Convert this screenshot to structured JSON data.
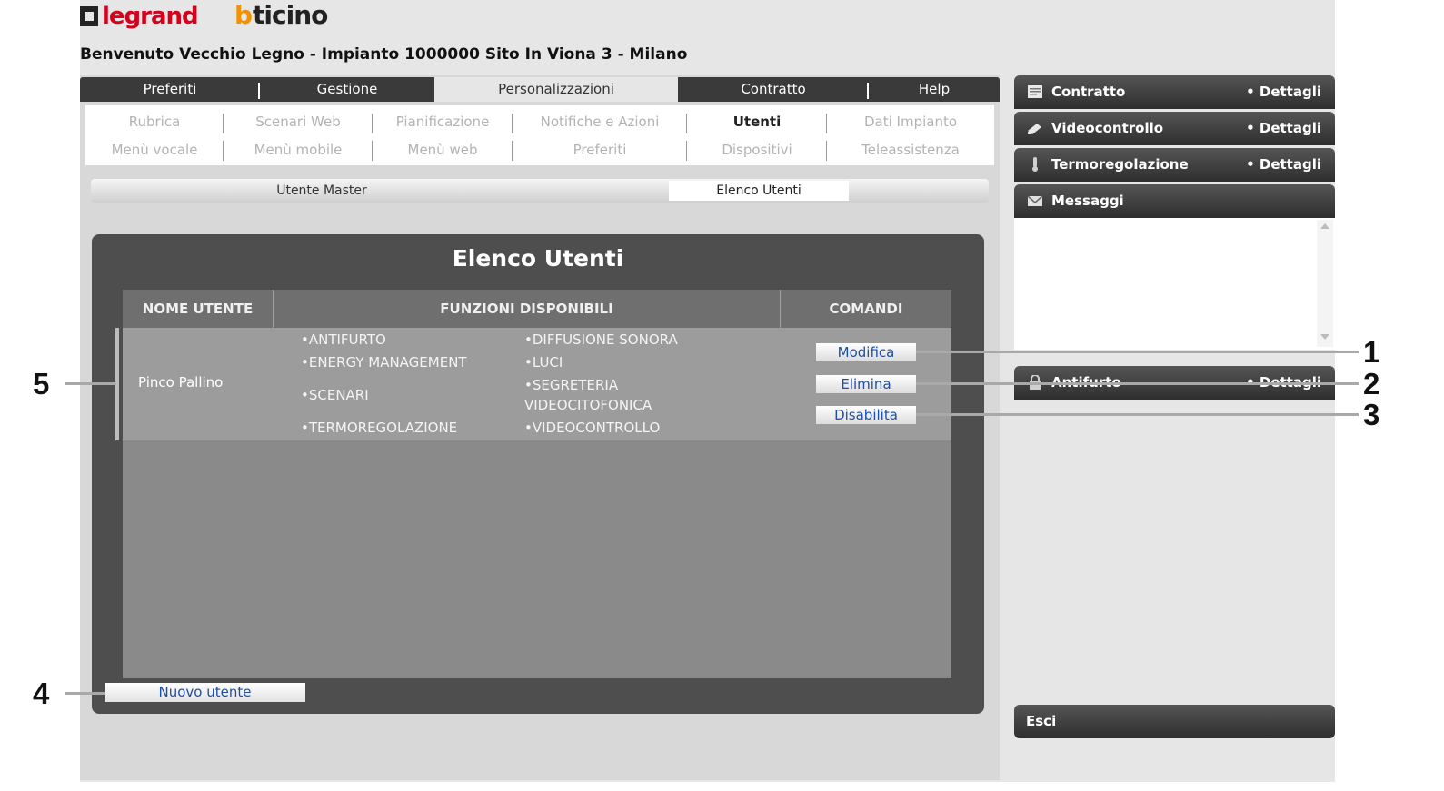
{
  "brand": {
    "legrand": "legrand",
    "bticino_b": "b",
    "bticino_rest": "ticino"
  },
  "welcome": "Benvenuto Vecchio Legno - Impianto 1000000 Sito In Viona 3 - Milano",
  "tabs": [
    {
      "label": "Preferiti"
    },
    {
      "label": "Gestione"
    },
    {
      "label": "Personalizzazioni",
      "active": true
    },
    {
      "label": "Contratto"
    },
    {
      "label": "Help"
    }
  ],
  "submenu": {
    "row1": [
      "Rubrica",
      "Scenari Web",
      "Pianificazione",
      "Notifiche e Azioni",
      "Utenti",
      "Dati Impianto"
    ],
    "row2": [
      "Menù vocale",
      "Menù mobile",
      "Menù web",
      "Preferiti",
      "Dispositivi",
      "Teleassistenza"
    ],
    "active": "Utenti"
  },
  "subtabs": {
    "master": "Utente Master",
    "elenco": "Elenco Utenti"
  },
  "panel": {
    "title": "Elenco Utenti",
    "headers": {
      "name": "NOME UTENTE",
      "functions": "FUNZIONI DISPONIBILI",
      "commands": "COMANDI"
    },
    "user": {
      "name": "Pinco Pallino",
      "functions_col1": [
        "•ANTIFURTO",
        "•ENERGY MANAGEMENT",
        "•SCENARI",
        "•TERMOREGOLAZIONE"
      ],
      "functions_col2": [
        "•DIFFUSIONE SONORA",
        "•LUCI",
        "•SEGRETERIA",
        "VIDEOCITOFONICA",
        "•VIDEOCONTROLLO"
      ]
    },
    "commands": {
      "edit": "Modifica",
      "delete": "Elimina",
      "disable": "Disabilita"
    },
    "new_user": "Nuovo utente"
  },
  "sidebar": {
    "contratto": "Contratto",
    "videocontrollo": "Videocontrollo",
    "termoregolazione": "Termoregolazione",
    "messaggi": "Messaggi",
    "antifurto": "Antifurto",
    "details": "• Dettagli",
    "exit": "Esci"
  },
  "callouts": {
    "c1": "1",
    "c2": "2",
    "c3": "3",
    "c4": "4",
    "c5": "5"
  },
  "colors": {
    "link": "#1f4ea3",
    "panel": "#4e4e4e",
    "tabbar": "#3a3a3a"
  }
}
